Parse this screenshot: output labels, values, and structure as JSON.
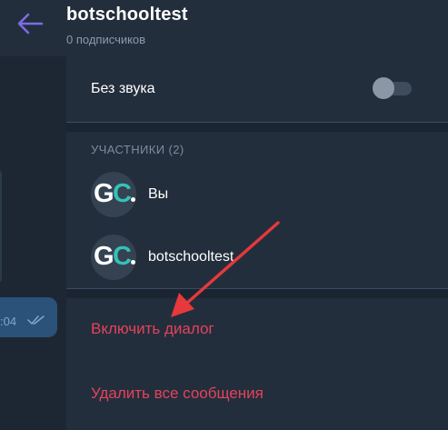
{
  "header": {
    "title": "botschooltest",
    "subtitle": "0 подписчиков",
    "back_icon": "arrow-left-icon",
    "back_color": "#7b6ce6"
  },
  "chat": {
    "message_time": ":04",
    "read_icon": "double-check-icon"
  },
  "settings": {
    "mute_label": "Без звука",
    "mute_enabled": false
  },
  "members": {
    "section_title": "УЧАСТНИКИ (2)",
    "items": [
      {
        "name": "Вы",
        "avatar_text": "GC",
        "avatar_accent": "#36c0b7"
      },
      {
        "name": "botschooltest",
        "avatar_text": "GC",
        "avatar_accent": "#36c0b7"
      }
    ]
  },
  "actions": {
    "enable_dialog": "Включить диалог",
    "delete_all": "Удалить все сообщения",
    "color": "#e4425c"
  },
  "annotation": {
    "arrow_color": "#e5393b",
    "arrow_icon": "annotation-arrow-icon"
  }
}
